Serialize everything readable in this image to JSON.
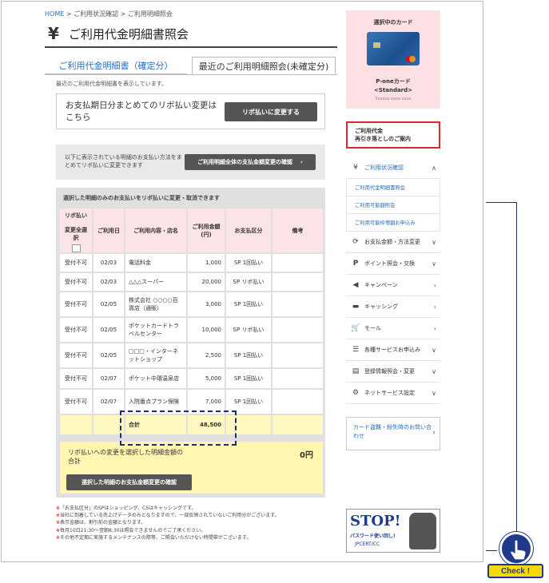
{
  "breadcrumb": {
    "home": "HOME",
    "sep": ">",
    "item1": "ご利用状況確認",
    "item2": "ご利用明細照会"
  },
  "page": {
    "yen_icon": "¥",
    "title": "ご利用代金明細書照会"
  },
  "tabs": [
    {
      "label": "ご利用代金明細書（確定分）"
    },
    {
      "label": "最近のご利用明細照会(未確定分)"
    }
  ],
  "description": "最近のご利用代金明細書を表示しています。",
  "revo_all": {
    "text": "お支払期日分まとめてのリボ払い変更はこちら",
    "button": "リボ払いに変更する"
  },
  "confirm_all": {
    "text": "以下に表示されている明細のお支払い方法をまとめてリボ払いに変更できます",
    "button": "ご利用明細全体の支払金額変更の確認",
    "arrow": "›"
  },
  "table": {
    "note": "選択した明細のみのお支払いをリボ払いに変更・取消できます",
    "headers": {
      "revo": "リボ払い",
      "select_all": "変更全選択",
      "date": "ご利用日",
      "desc": "ご利用内容・店名",
      "amount": "ご利用金額(円)",
      "payment": "お支払区分",
      "memo": "備考"
    },
    "rows": [
      {
        "status": "受付不可",
        "date": "02/03",
        "desc": "電話料金",
        "amount": "1,000",
        "payment": "SP 1回払い",
        "memo": ""
      },
      {
        "status": "受付不可",
        "date": "02/03",
        "desc": "△△△スーパー",
        "amount": "20,000",
        "payment": "SP リボ払い",
        "memo": ""
      },
      {
        "status": "受付不可",
        "date": "02/05",
        "desc": "株式会社 ○○○○百貨店（通販）",
        "amount": "3,000",
        "payment": "SP 1回払い",
        "memo": ""
      },
      {
        "status": "受付不可",
        "date": "02/05",
        "desc": "ポケットカードトラベルセンター",
        "amount": "10,000",
        "payment": "SP リボ払い",
        "memo": ""
      },
      {
        "status": "受付不可",
        "date": "02/05",
        "desc": "□□□・インターネットショップ",
        "amount": "2,500",
        "payment": "SP 1回払い",
        "memo": ""
      },
      {
        "status": "受付不可",
        "date": "02/07",
        "desc": "ポケット中環温泉店",
        "amount": "5,000",
        "payment": "SP 1回払い",
        "memo": ""
      },
      {
        "status": "受付不可",
        "date": "02/07",
        "desc": "入院番点プラン保険",
        "amount": "7,000",
        "payment": "SP 1回払い",
        "memo": ""
      }
    ],
    "total_label": "合計",
    "total_amount": "48,500"
  },
  "selected": {
    "text": "リボ払いへの変更を選択した明細金額の合計",
    "amount": "0円",
    "button": "選択した明細のお支払金額変更の確認"
  },
  "notes": {
    "mark": "※",
    "lines": [
      "「お支払区分」のSPはショッピング、CSはキャッシングです。",
      "当社に到着している売上げデータのみとなりますので、一部反映されていないご利用分がございます。",
      "表示金額は、割引前の金額となります。",
      "毎月10日21:30～翌朝8:30は照会できませんのでご了承ください。",
      "その他不定期に実施するメンテナンスの際等、ご照会いただけない時間帯がございます。"
    ]
  },
  "sidebar": {
    "card_label": "選択中のカード",
    "card_name": "P-oneカード",
    "card_type": "<Standard>",
    "card_number": "5xxxxx-xxxx-xxxx",
    "red_box": {
      "line1": "ご利用代金",
      "line2": "再引き落としのご案内"
    },
    "menu_open": {
      "label": "ご利用状況確認",
      "icon": "yen-icon",
      "submenu": [
        "ご利用代金明細書照会",
        "ご利用可能額照会",
        "ご利用可能枠増額お申込み"
      ]
    },
    "menu": [
      {
        "label": "お支払金額・方法変更",
        "icon": "refresh-icon"
      },
      {
        "label": "ポイント照会・交換",
        "icon": "point-icon"
      },
      {
        "label": "キャンペーン",
        "icon": "megaphone-icon"
      },
      {
        "label": "キャッシング",
        "icon": "card-icon"
      },
      {
        "label": "モール",
        "icon": "cart-icon"
      },
      {
        "label": "各種サービスお申込み",
        "icon": "list-icon"
      },
      {
        "label": "登録情報照会・変更",
        "icon": "document-icon"
      },
      {
        "label": "ネットサービス設定",
        "icon": "gear-icon"
      }
    ],
    "theft": "カード盗難・紛失時のお問い合わせ",
    "stop": {
      "big": "STOP!",
      "sub1": "パスワード使い回し!",
      "sub2": "JPCERT/CC"
    }
  },
  "callout": {
    "label": "Check !"
  }
}
